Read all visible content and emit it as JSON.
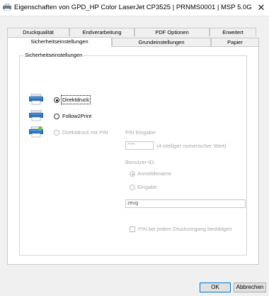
{
  "window": {
    "title": "Eigenschaften von GPD_HP Color LaserJet CP3525 | PRNMS0001 | MSP 5.0G Z...",
    "close_glyph": "✕"
  },
  "tabs": {
    "row1": [
      "Druckqualität",
      "Endverarbeitung",
      "PDF Optionen",
      "Erweitert"
    ],
    "row2": [
      "Sicherheitseinstellungen",
      "Grundeinstellungen",
      "Papier"
    ],
    "active": "Sicherheitseinstellungen"
  },
  "security": {
    "group_title": "Sicherheitseinstellungen",
    "options": [
      {
        "label": "Direktdruck",
        "checked": true,
        "disabled": false,
        "icon": "printer-icon"
      },
      {
        "label": "Follow2Print",
        "checked": false,
        "disabled": false,
        "icon": "printer-icon"
      },
      {
        "label": "Direktdruck mit PIN",
        "checked": false,
        "disabled": true,
        "icon": "printer-pin-icon"
      }
    ],
    "pin": {
      "label": "PIN Eingabe:",
      "value": "****",
      "hint": "(4-stelliger numerischer Wert)"
    },
    "user": {
      "label": "Benutzer-ID:",
      "options": [
        {
          "label": "Anmeldename",
          "checked": true
        },
        {
          "label": "Eingabe:",
          "checked": false
        }
      ],
      "value": "zeug"
    },
    "confirm_pin": {
      "label": "PIN bei jedem Druckvorgang bestätigen",
      "checked": false
    }
  },
  "buttons": {
    "ok": "OK",
    "cancel": "Abbrechen"
  },
  "colors": {
    "accent": "#0078d7",
    "disabled_text": "#a8a8a8"
  }
}
